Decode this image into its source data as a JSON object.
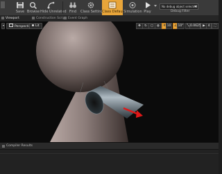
{
  "toolbar": {
    "buttons": [
      {
        "label": "Save",
        "icon": "save-icon"
      },
      {
        "label": "Browse",
        "icon": "magnifier-icon"
      },
      {
        "label": "Hide Unrelated",
        "icon": "hide-unrelated-icon"
      },
      {
        "label": "Find",
        "icon": "binoculars-icon"
      },
      {
        "label": "Class Settings",
        "icon": "gear-icon"
      },
      {
        "label": "Class Defaults",
        "icon": "class-defaults-icon"
      },
      {
        "label": "Simulation",
        "icon": "simulation-icon"
      },
      {
        "label": "Play",
        "icon": "play-icon"
      }
    ],
    "debug_object": "No debug object selected",
    "debug_filter_label": "Debug Filter",
    "accent_color": "#e8a53a"
  },
  "tabs": [
    {
      "label": "Viewport"
    },
    {
      "label": "Construction Script"
    },
    {
      "label": "Event Graph"
    }
  ],
  "viewport": {
    "view_mode": "Perspective",
    "lit_mode": "Lit",
    "grid_snap": "10",
    "rotation_snap": "10°",
    "scale_snap": "0.0625",
    "camera_speed": "4"
  },
  "compiler": {
    "title": "Compiler Results"
  },
  "colors": {
    "toolbar_bg": "#3a3a3a",
    "viewport_bg": "#0b0b0b",
    "arrow_red": "#e01818"
  }
}
